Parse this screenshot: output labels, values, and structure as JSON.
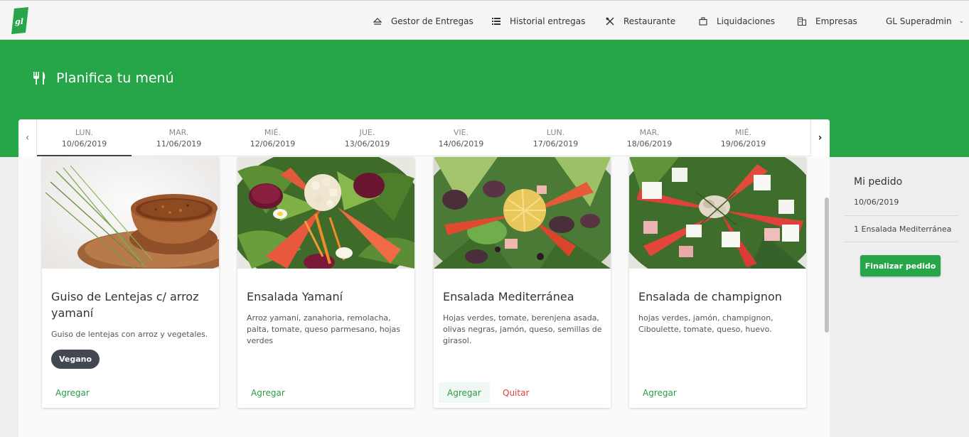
{
  "navbar": {
    "logo_text": "gl",
    "items": [
      {
        "label": "Gestor de Entregas",
        "icon": "eject-icon"
      },
      {
        "label": "Historial entregas",
        "icon": "list-icon"
      },
      {
        "label": "Restaurante",
        "icon": "utensils-crossed-icon"
      },
      {
        "label": "Liquidaciones",
        "icon": "briefcase-icon"
      },
      {
        "label": "Empresas",
        "icon": "building-icon"
      }
    ],
    "user_label": "GL Superadmin"
  },
  "banner": {
    "title": "Planifica tu menú",
    "icon": "utensils-icon"
  },
  "colors": {
    "brand_green": "#26a648",
    "navbar_bg": "#f5f5f5",
    "badge_bg": "#434752",
    "remove_red": "#e0403f"
  },
  "days": [
    {
      "day": "LUN.",
      "date": "10/06/2019",
      "active": true
    },
    {
      "day": "MAR.",
      "date": "11/06/2019",
      "active": false
    },
    {
      "day": "MIÉ.",
      "date": "12/06/2019",
      "active": false
    },
    {
      "day": "JUE.",
      "date": "13/06/2019",
      "active": false
    },
    {
      "day": "VIE.",
      "date": "14/06/2019",
      "active": false
    },
    {
      "day": "LUN.",
      "date": "17/06/2019",
      "active": false
    },
    {
      "day": "MAR.",
      "date": "18/06/2019",
      "active": false
    },
    {
      "day": "MIÉ.",
      "date": "19/06/2019",
      "active": false
    }
  ],
  "menu_items": [
    {
      "name": "Guiso de Lentejas c/ arroz yamaní",
      "description": "Guiso de lentejas con arroz y vegetales.",
      "badge": "Vegano",
      "add_label": "Agregar"
    },
    {
      "name": "Ensalada Yamaní",
      "description": "Arroz yamaní, zanahoria, remolacha, palta, tomate, queso parmesano, hojas verdes",
      "add_label": "Agregar"
    },
    {
      "name": "Ensalada Mediterránea",
      "description": "Hojas verdes, tomate, berenjena asada, olivas negras, jamón, queso, semillas de girasol.",
      "add_label": "Agregar",
      "remove_label": "Quitar"
    },
    {
      "name": "Ensalada de champignon",
      "description": "hojas verdes, jamón, champignon, Ciboulette, tomate, queso, huevo.",
      "add_label": "Agregar"
    }
  ],
  "order": {
    "title": "Mi pedido",
    "date": "10/06/2019",
    "entry": "1 Ensalada Mediterránea",
    "button_label": "Finalizar pedido"
  }
}
